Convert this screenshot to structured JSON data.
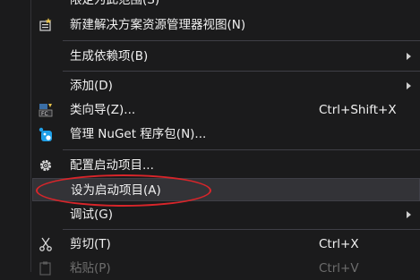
{
  "menu": {
    "items": {
      "limit_scope": {
        "label": "限定为此范围(S)"
      },
      "new_view": {
        "label": "新建解决方案资源管理器视图(N)",
        "icon": "new-view-icon"
      },
      "build_deps": {
        "label": "生成依赖项(B)"
      },
      "add": {
        "label": "添加(D)"
      },
      "class_wizard": {
        "label": "类向导(Z)...",
        "shortcut": "Ctrl+Shift+X",
        "icon": "class-wizard-icon"
      },
      "nuget": {
        "label": "管理 NuGet 程序包(N)...",
        "icon": "nuget-icon"
      },
      "config_startup": {
        "label": "配置启动项目...",
        "icon": "gear-icon"
      },
      "set_startup": {
        "label": "设为启动项目(A)"
      },
      "debug": {
        "label": "调试(G)"
      },
      "cut": {
        "label": "剪切(T)",
        "shortcut": "Ctrl+X",
        "icon": "scissors-icon"
      },
      "paste": {
        "label": "粘贴(P)",
        "shortcut": "Ctrl+V",
        "icon": "paste-icon"
      }
    }
  },
  "colors": {
    "background": "#1b1b1c",
    "highlight": "#333337",
    "annotation": "#d8252a",
    "nuget_blue": "#1e9fe8"
  }
}
